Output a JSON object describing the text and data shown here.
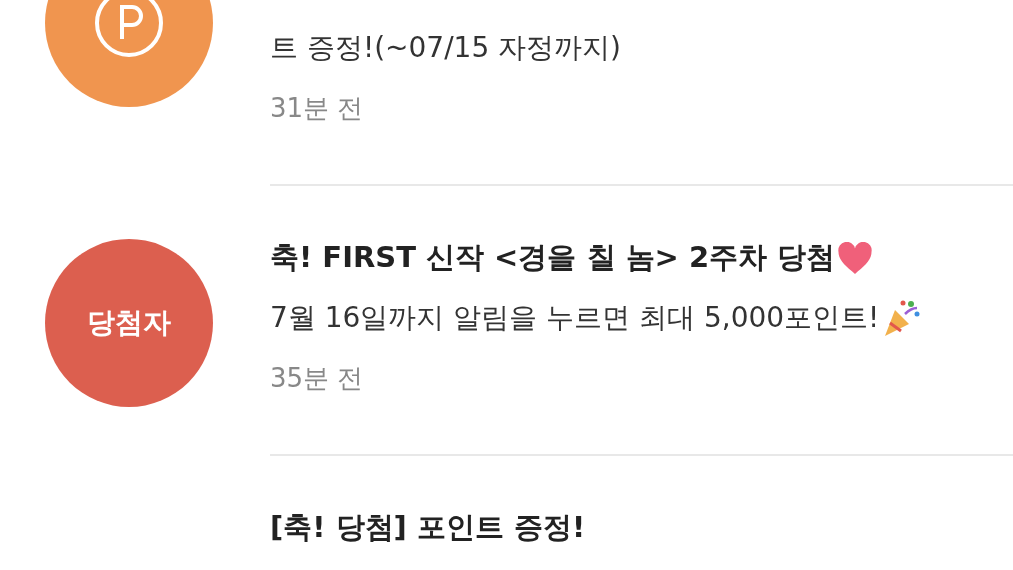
{
  "notifications": [
    {
      "avatar": {
        "kind": "point",
        "color": "#f0954f"
      },
      "lines": [
        "트 증정!(~07/15 자정까지)"
      ],
      "time": "31분 전",
      "party": false
    },
    {
      "avatar": {
        "kind": "label",
        "label": "당첨자",
        "color": "#dc5f4f"
      },
      "title": "축! FIRST 신작 <경을 칠 놈> 2주차 당첨",
      "heart": true,
      "lines": [
        "7월 16일까지 알림을 누르면 최대 5,000포인트!"
      ],
      "party": true,
      "time": "35분 전"
    },
    {
      "title": "[축! 당첨] 포인트 증정!",
      "heart": false
    }
  ]
}
